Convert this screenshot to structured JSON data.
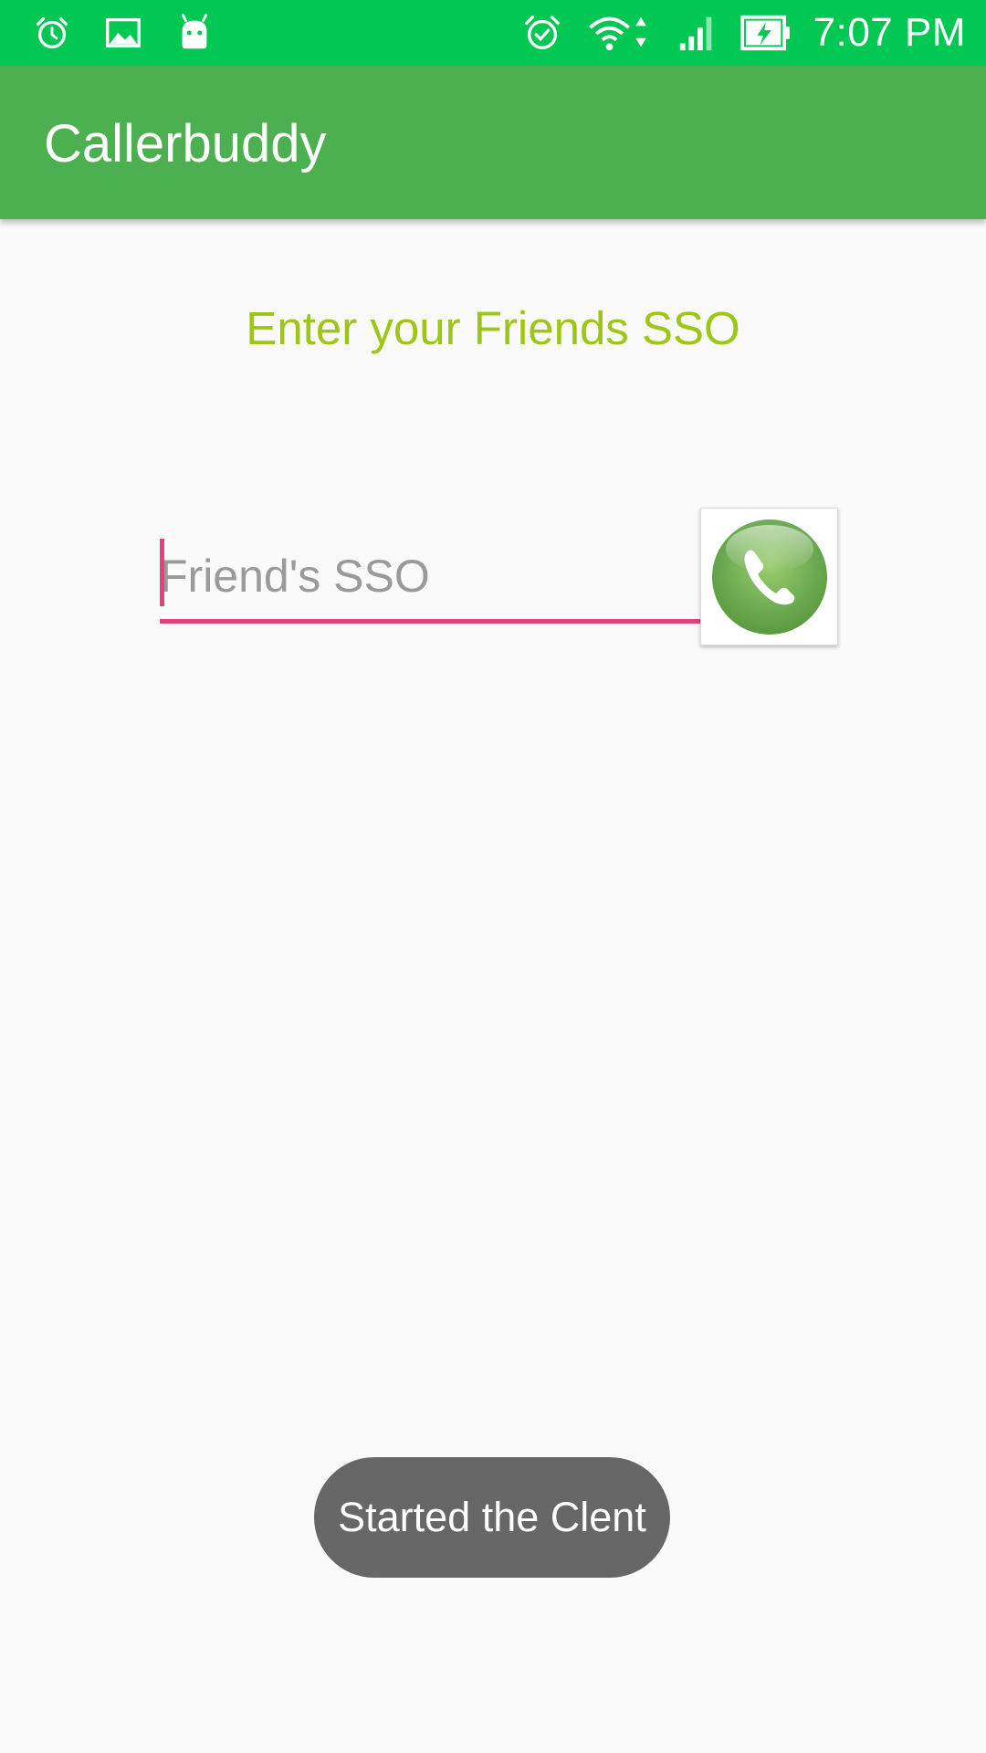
{
  "status_bar": {
    "left_icons": [
      "alarm-clock-icon",
      "image-icon",
      "android-icon"
    ],
    "right_icons": [
      "alarm-check-icon",
      "wifi-icon",
      "signal-icon",
      "battery-charging-icon"
    ],
    "time": "7:07 PM"
  },
  "app_bar": {
    "title": "Callerbuddy"
  },
  "main": {
    "prompt": "Enter your Friends SSO",
    "sso_input": {
      "value": "",
      "placeholder": "Friend's SSO"
    },
    "call_button_icon": "phone-icon"
  },
  "toast": {
    "message": "Started the Clent"
  },
  "colors": {
    "status_bar": "#00c853",
    "app_bar": "#4caf50",
    "prompt_text": "#9dc619",
    "accent": "#e5417d",
    "toast_bg": "#676767"
  }
}
